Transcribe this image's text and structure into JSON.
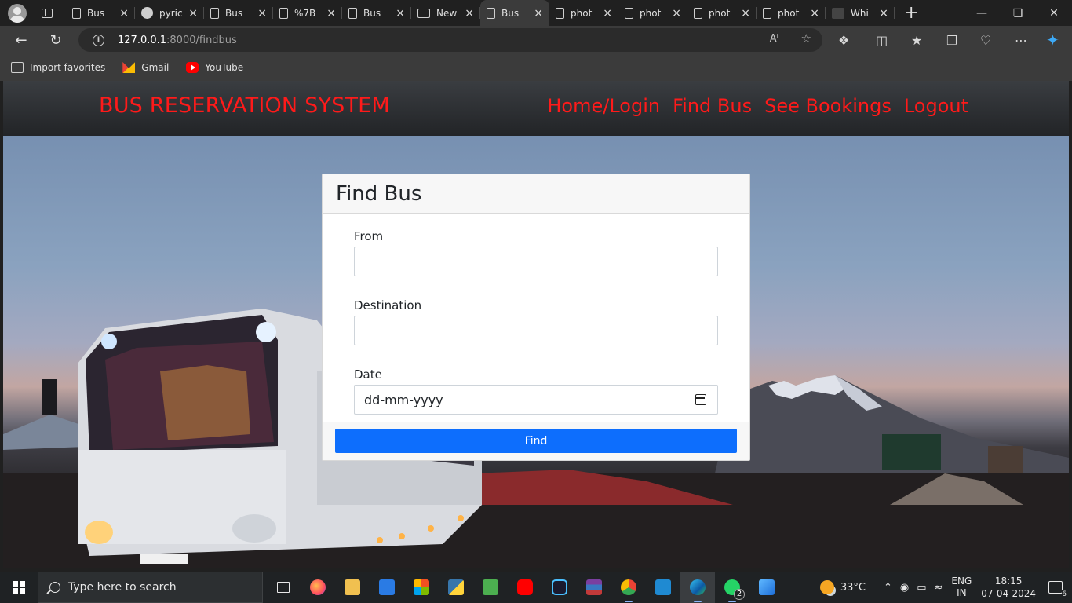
{
  "browser": {
    "tabs": [
      {
        "title": "Bus",
        "icon": "page-icon",
        "active": false
      },
      {
        "title": "pyric",
        "icon": "github-icon",
        "active": false
      },
      {
        "title": "Bus",
        "icon": "page-icon",
        "active": false
      },
      {
        "title": "%7B",
        "icon": "page-icon",
        "active": false
      },
      {
        "title": "Bus",
        "icon": "page-icon",
        "active": false
      },
      {
        "title": "New",
        "icon": "image-icon",
        "active": false
      },
      {
        "title": "Bus",
        "icon": "page-icon",
        "active": true
      },
      {
        "title": "phot",
        "icon": "page-icon",
        "active": false
      },
      {
        "title": "phot",
        "icon": "page-icon",
        "active": false
      },
      {
        "title": "phot",
        "icon": "page-icon",
        "active": false
      },
      {
        "title": "phot",
        "icon": "page-icon",
        "active": false
      },
      {
        "title": "Whi",
        "icon": "site-icon",
        "active": false
      }
    ],
    "url_host": "127.0.0.1",
    "url_path": ":8000/findbus",
    "favorites": [
      {
        "label": "Import favorites",
        "icon": "import-icon"
      },
      {
        "label": "Gmail",
        "icon": "gmail-icon"
      },
      {
        "label": "YouTube",
        "icon": "youtube-icon"
      }
    ]
  },
  "site": {
    "brand": "BUS RESERVATION SYSTEM",
    "nav": [
      "Home/Login",
      "Find Bus",
      "See Bookings",
      "Logout"
    ],
    "accent_color": "#ff1a1a"
  },
  "find_form": {
    "title": "Find Bus",
    "from_label": "From",
    "from_value": "",
    "destination_label": "Destination",
    "destination_value": "",
    "date_label": "Date",
    "date_placeholder": "dd-mm-yyyy",
    "submit_label": "Find",
    "button_color": "#0d6efd"
  },
  "taskbar": {
    "search_placeholder": "Type here to search",
    "weather": "33°C",
    "lang_line1": "ENG",
    "lang_line2": "IN",
    "time": "18:15",
    "date": "07-04-2024",
    "whatsapp_badge": "2",
    "notification_count": "6"
  }
}
